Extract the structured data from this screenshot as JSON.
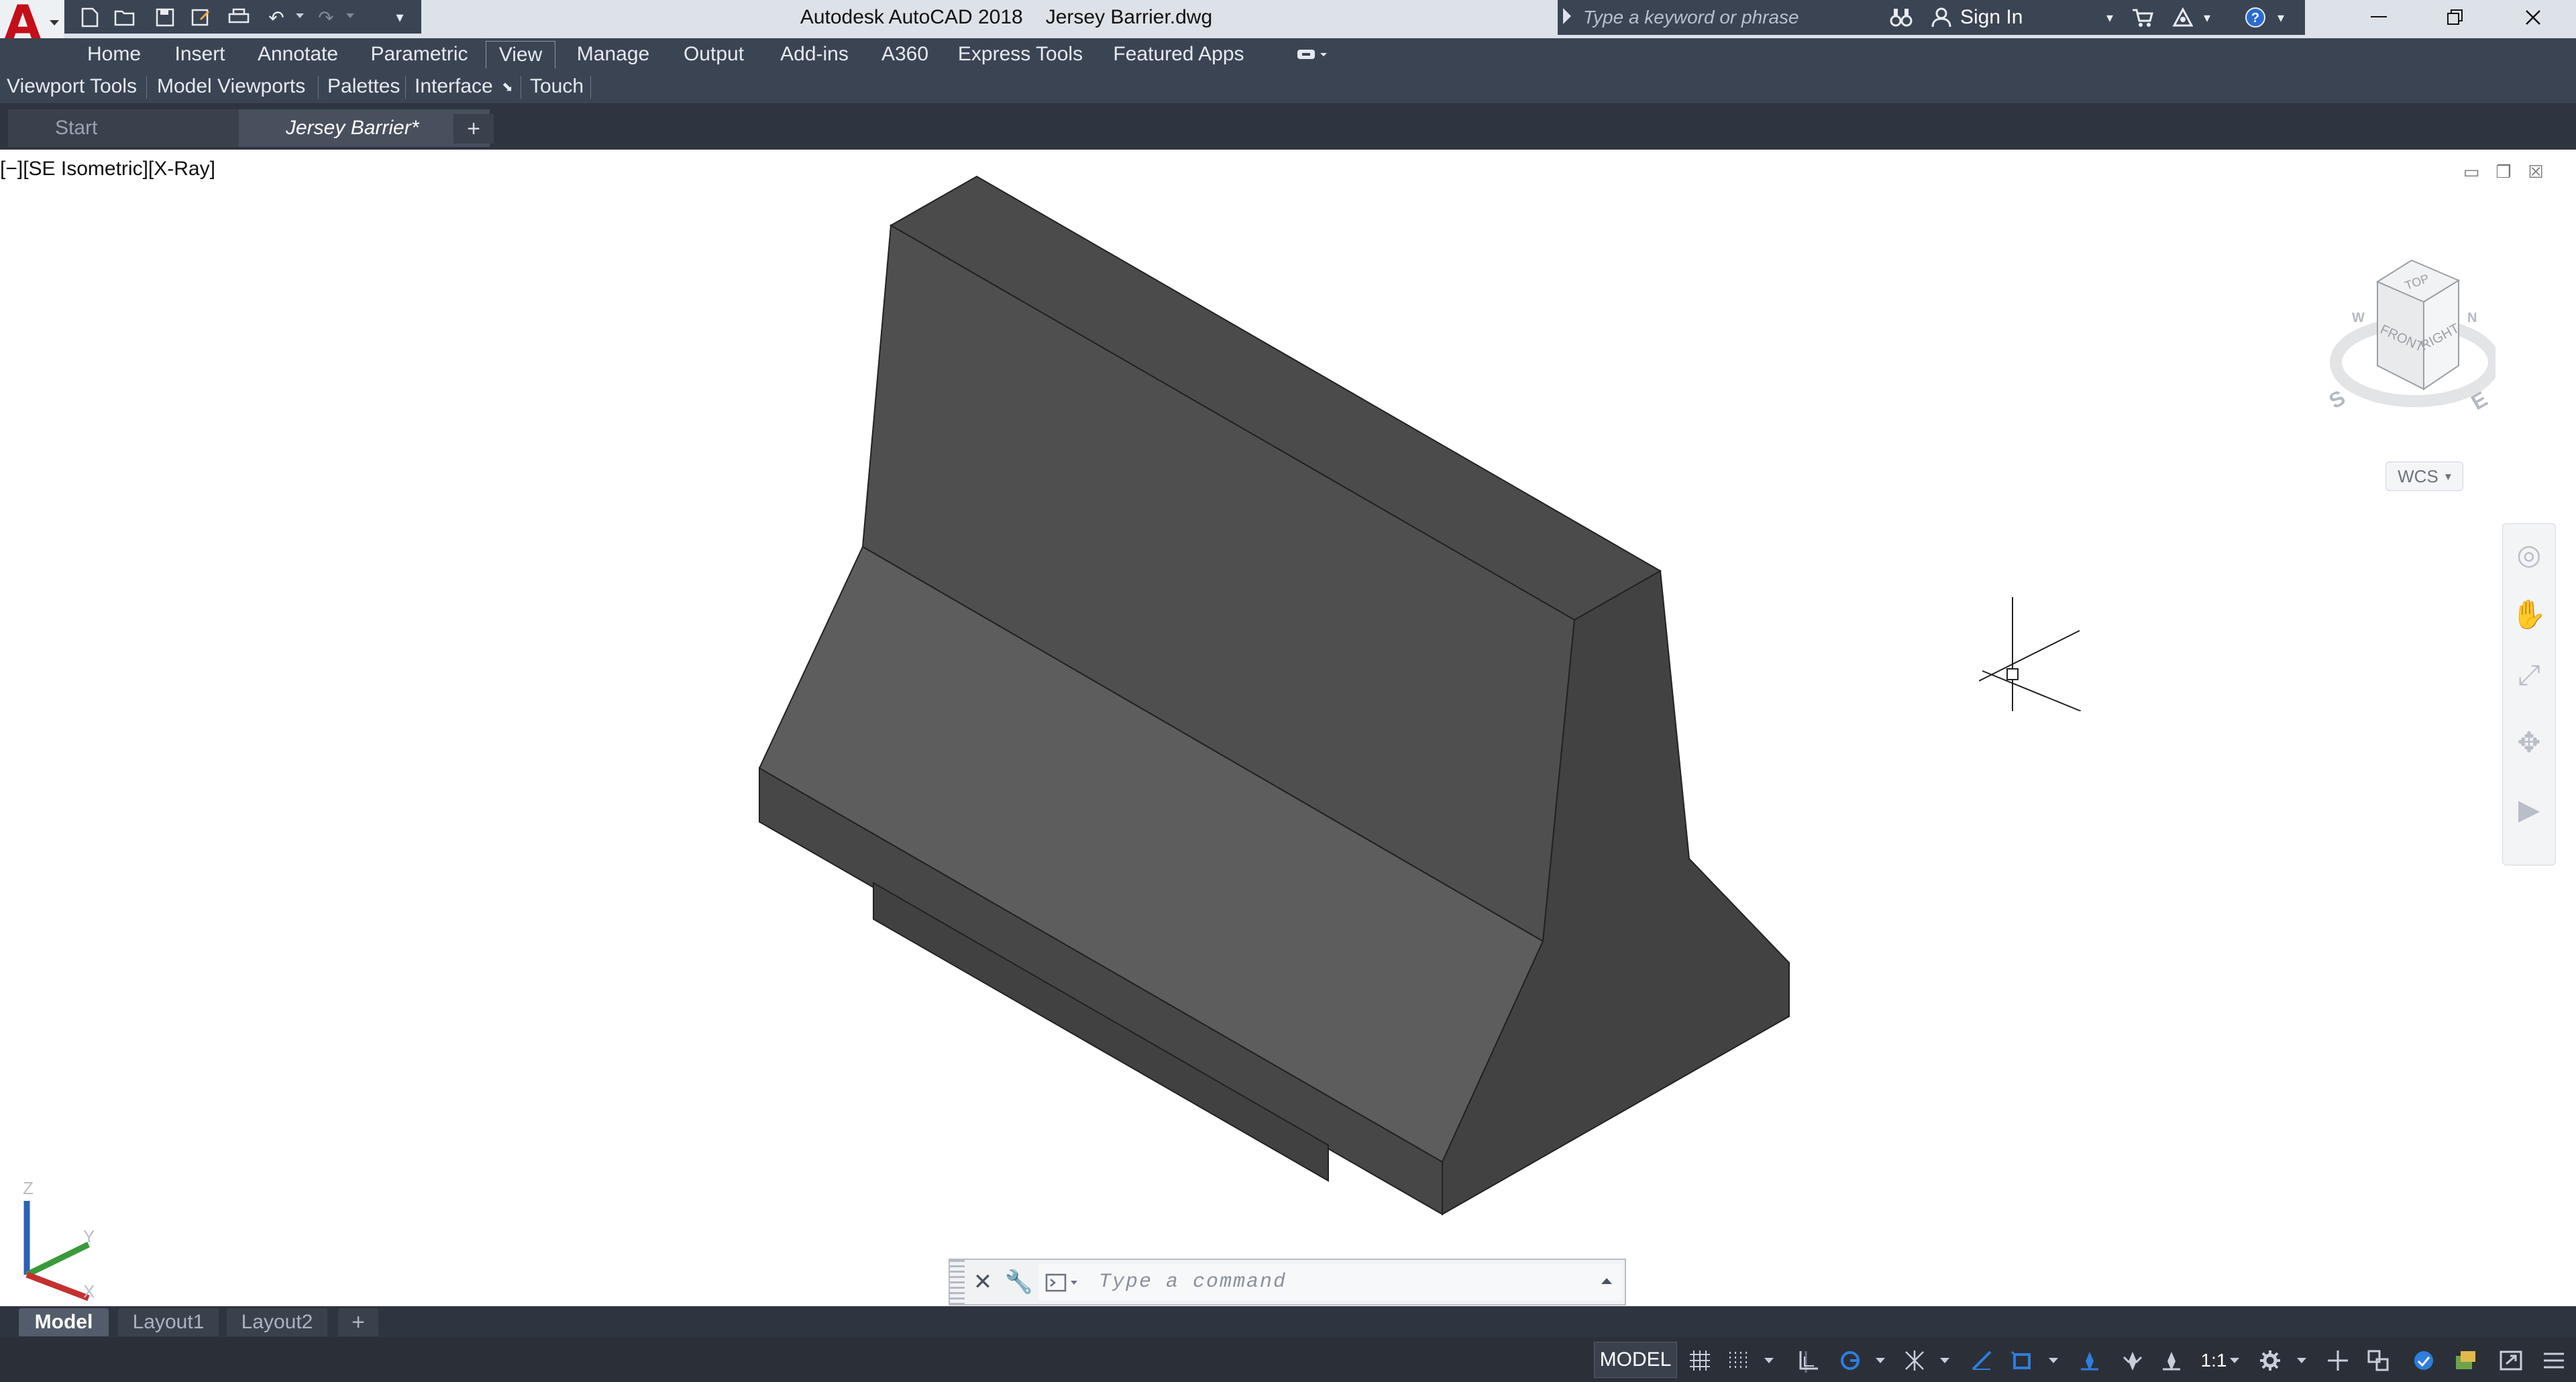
{
  "app": {
    "logo_letter": "A",
    "title": "Autodesk AutoCAD 2018",
    "file_name": "Jersey Barrier.dwg"
  },
  "search": {
    "placeholder": "Type a keyword or phrase"
  },
  "account": {
    "sign_in": "Sign In"
  },
  "ribbon": {
    "tabs": [
      "Home",
      "Insert",
      "Annotate",
      "Parametric",
      "View",
      "Manage",
      "Output",
      "Add-ins",
      "A360",
      "Express Tools",
      "Featured Apps"
    ],
    "active_tab": "View",
    "panels": [
      "Viewport Tools",
      "Model Viewports",
      "Palettes",
      "Interface",
      "Touch"
    ]
  },
  "doc_tabs": [
    {
      "label": "Start"
    },
    {
      "label": "Jersey Barrier*"
    }
  ],
  "viewport": {
    "label": "[−][SE Isometric][X-Ray]",
    "viewcube": {
      "top": "TOP",
      "front": "FRONT",
      "right": "RIGHT",
      "compass": [
        "N",
        "W",
        "S",
        "E"
      ]
    },
    "wcs": "WCS",
    "ucs": {
      "x": "X",
      "y": "Y",
      "z": "Z"
    }
  },
  "command": {
    "placeholder": "Type a command"
  },
  "layout_tabs": [
    "Model",
    "Layout1",
    "Layout2"
  ],
  "status": {
    "model": "MODEL",
    "scale": "1:1"
  },
  "colors": {
    "accent_red": "#c40f1a",
    "ui_dark": "#3b4453",
    "barrier_top": "#4e4e4e",
    "barrier_slope": "#5c5c5c",
    "barrier_side": "#404040",
    "status_blue": "#2f7dde"
  },
  "icons": [
    "new-icon",
    "open-icon",
    "save-icon",
    "saveas-icon",
    "plot-icon",
    "undo-icon",
    "redo-icon",
    "binoculars-icon",
    "user-icon",
    "cart-icon",
    "exchange-icon",
    "help-icon",
    "minimize-icon",
    "restore-icon",
    "close-icon",
    "grid-icon",
    "snap-icon",
    "ortho-icon",
    "polar-icon",
    "osnap-icon",
    "gear-icon",
    "fullscreen-icon",
    "customize-icon"
  ]
}
